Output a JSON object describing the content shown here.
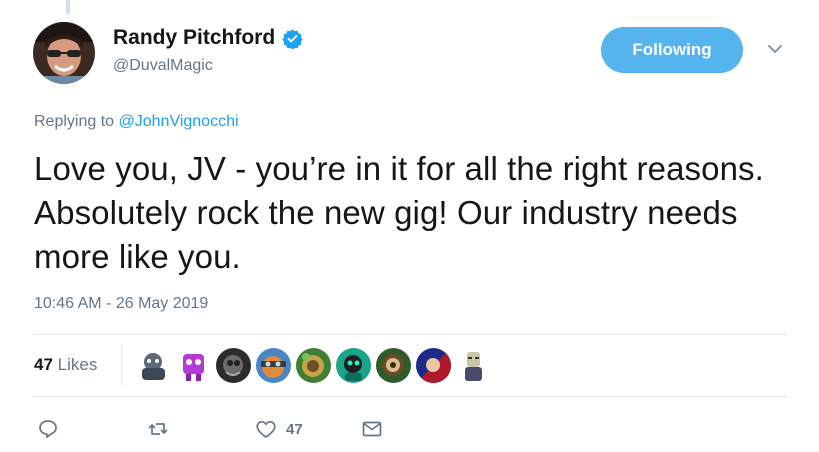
{
  "author": {
    "display_name": "Randy Pitchford",
    "handle": "@DuvalMagic",
    "verified": true,
    "avatar_icon": "user-avatar-photo"
  },
  "follow_button": {
    "label": "Following",
    "color": "#55b4ee"
  },
  "menu_icon": "chevron-down-icon",
  "reply": {
    "prefix": "Replying to",
    "mention": "@JohnVignocchi"
  },
  "tweet": {
    "text": "Love you, JV - you’re in it for all the right reasons. Absolutely rock the new gig! Our industry needs more like you.",
    "timestamp": "10:46 AM - 26 May 2019"
  },
  "likes": {
    "count": "47",
    "label": "Likes",
    "avatars": [
      "liker-avatar-1",
      "liker-avatar-2",
      "liker-avatar-3",
      "liker-avatar-4",
      "liker-avatar-5",
      "liker-avatar-6",
      "liker-avatar-7",
      "liker-avatar-8",
      "liker-avatar-9"
    ]
  },
  "actions": {
    "reply_icon": "reply-icon",
    "retweet_icon": "retweet-icon",
    "like_icon": "heart-icon",
    "like_count": "47",
    "dm_icon": "envelope-icon"
  },
  "colors": {
    "accent": "#1da1f2",
    "muted": "#657786",
    "text": "#14171a",
    "divider": "#e1e8ed"
  }
}
